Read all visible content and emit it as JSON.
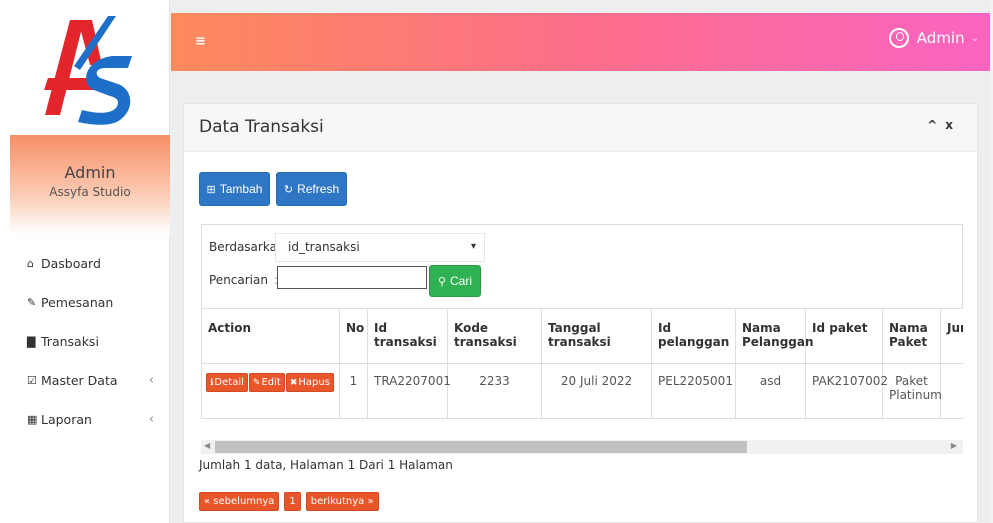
{
  "sidebar": {
    "logo_text": "AS",
    "user_name": "Admin",
    "user_subtitle": "Assyfa Studio",
    "menu": [
      {
        "label": "Dasboard",
        "icon": "home-icon",
        "glyph": "⌂",
        "has_children": false
      },
      {
        "label": "Pemesanan",
        "icon": "pencil-icon",
        "glyph": "✎",
        "has_children": false
      },
      {
        "label": "Transaksi",
        "icon": "book-icon",
        "glyph": "▇",
        "has_children": false
      },
      {
        "label": "Master Data",
        "icon": "edit-icon",
        "glyph": "☑",
        "has_children": true
      },
      {
        "label": "Laporan",
        "icon": "calendar-icon",
        "glyph": "▦",
        "has_children": true
      }
    ],
    "chevron": "‹"
  },
  "topbar": {
    "menu_toggle": "≡",
    "user_label": "Admin",
    "chevron": "⌄"
  },
  "box": {
    "title": "Data Transaksi",
    "collapse_glyph": "^",
    "close_glyph": "x",
    "tambah_label": "Tambah",
    "refresh_label": "Refresh",
    "berdasarkan_label": "Berdasarkan:",
    "select_value": "id_transaksi",
    "pencarian_label": "Pencarian",
    "colon": ":",
    "search_value": "",
    "cari_label": "Cari"
  },
  "table": {
    "headers": [
      "Action",
      "No",
      "Id transaksi",
      "Kode transaksi",
      "Tanggal transaksi",
      "Id pelanggan",
      "Nama Pelanggan",
      "Id paket",
      "Nama Paket",
      "Jumlah"
    ],
    "rows": [
      {
        "actions": [
          "Detail",
          "Edit",
          "Hapus"
        ],
        "no": "1",
        "id_transaksi": "TRA2207001",
        "kode_transaksi": "2233",
        "tanggal_transaksi": "20 Juli 2022",
        "id_pelanggan": "PEL2205001",
        "nama_pelanggan": "asd",
        "id_paket": "PAK2107002",
        "nama_paket": "Paket Platinum",
        "jumlah": ""
      }
    ]
  },
  "info_text": "Jumlah 1 data, Halaman 1 Dari 1 Halaman",
  "pagination": {
    "prev": "« sebelumnya",
    "current": "1",
    "next": "berikutnya »"
  },
  "colors": {
    "topbar_start": "#fe8a5c",
    "topbar_end": "#fa64c2",
    "primary_button": "#2f77c4",
    "success_button": "#2fb253",
    "danger_button": "#e8562a",
    "logo_red": "#e3262b",
    "logo_blue": "#1e6fc7"
  }
}
